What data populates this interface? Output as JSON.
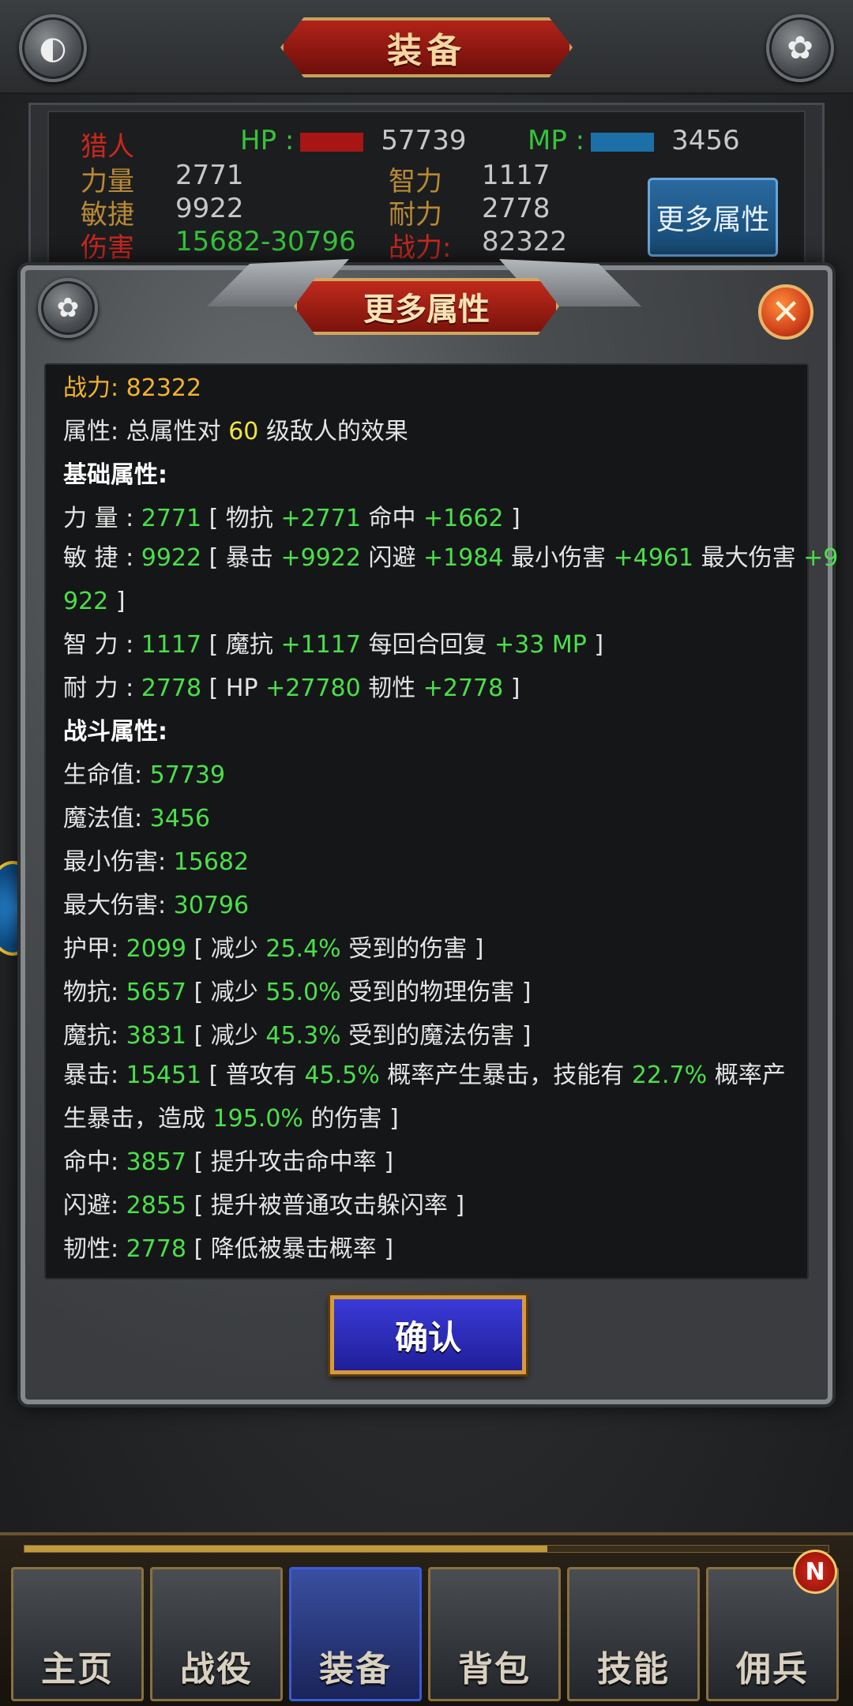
{
  "topbar": {
    "title": "装备",
    "left_icon": "helmet-icon",
    "right_icon": "paw-icon"
  },
  "stats": {
    "class": "猎人",
    "hp_label": "HP :",
    "hp_value": "57739",
    "mp_label": "MP :",
    "mp_value": "3456",
    "str_label": "力量",
    "str_value": "2771",
    "int_label": "智力",
    "int_value": "1117",
    "agi_label": "敏捷",
    "agi_value": "9922",
    "sta_label": "耐力",
    "sta_value": "2778",
    "dmg_label": "伤害",
    "dmg_value": "15682-30796",
    "power_label": "战力:",
    "power_value": "82322",
    "more_button": "更多属性"
  },
  "dialog": {
    "title": "更多属性",
    "power_label": "战力:",
    "power_value": "82322",
    "attr_prefix": "属性: 总属性对",
    "attr_level": "60",
    "attr_suffix": "级敌人的效果",
    "basic_header": "基础属性:",
    "str": {
      "label": "力 量 :",
      "value": "2771",
      "p1": "[ 物抗",
      "v1": "+2771",
      "p2": "命中",
      "v2": "+1662",
      "end": "]"
    },
    "agi": {
      "label": "敏 捷 :",
      "value": "9922",
      "p1": "[ 暴击",
      "v1": "+9922",
      "p2": "闪避",
      "v2": "+1984",
      "p3": "最小伤害",
      "v3": "+4961",
      "p4": "最大伤害",
      "v4a": "+9",
      "v4b": "922",
      "end": "]"
    },
    "int": {
      "label": "智 力 :",
      "value": "1117",
      "p1": "[ 魔抗",
      "v1": "+1117",
      "p2": "每回合回复",
      "v2": "+33 MP",
      "end": "]"
    },
    "sta": {
      "label": "耐 力 :",
      "value": "2778",
      "p1": "[ HP",
      "v1": "+27780",
      "p2": "韧性",
      "v2": "+2778",
      "end": "]"
    },
    "combat_header": "战斗属性:",
    "hp": {
      "label": "生命值:",
      "value": "57739"
    },
    "mp": {
      "label": "魔法值:",
      "value": "3456"
    },
    "min_dmg": {
      "label": "最小伤害:",
      "value": "15682"
    },
    "max_dmg": {
      "label": "最大伤害:",
      "value": "30796"
    },
    "armor": {
      "label": "护甲:",
      "value": "2099",
      "p1": "[ 减少",
      "pct": "25.4%",
      "p2": "受到的伤害 ]"
    },
    "phys_res": {
      "label": "物抗:",
      "value": "5657",
      "p1": "[ 减少",
      "pct": "55.0%",
      "p2": "受到的物理伤害 ]"
    },
    "magic_res": {
      "label": "魔抗:",
      "value": "3831",
      "p1": "[ 减少",
      "pct": "45.3%",
      "p2": "受到的魔法伤害 ]"
    },
    "crit": {
      "label": "暴击:",
      "value": "15451",
      "p1": "[ 普攻有",
      "pct1": "45.5%",
      "p2": "概率产生暴击，技能有",
      "pct2": "22.7%",
      "p3": "概率产",
      "p4": "生暴击，造成",
      "pct3": "195.0%",
      "p5": "的伤害 ]"
    },
    "hit": {
      "label": "命中:",
      "value": "3857",
      "desc": "[ 提升攻击命中率 ]"
    },
    "dodge": {
      "label": "闪避:",
      "value": "2855",
      "desc": "[ 提升被普通攻击躲闪率 ]"
    },
    "tough": {
      "label": "韧性:",
      "value": "2778",
      "desc": "[ 降低被暴击概率 ]"
    },
    "confirm": "确认"
  },
  "nav": {
    "items": [
      "主页",
      "战役",
      "装备",
      "背包",
      "技能",
      "佣兵"
    ],
    "active": "装备",
    "badge": "N"
  },
  "colors": {
    "green": "#4ae04a",
    "gold": "#f2b22e",
    "confirm_blue": "#2a2ac0"
  }
}
